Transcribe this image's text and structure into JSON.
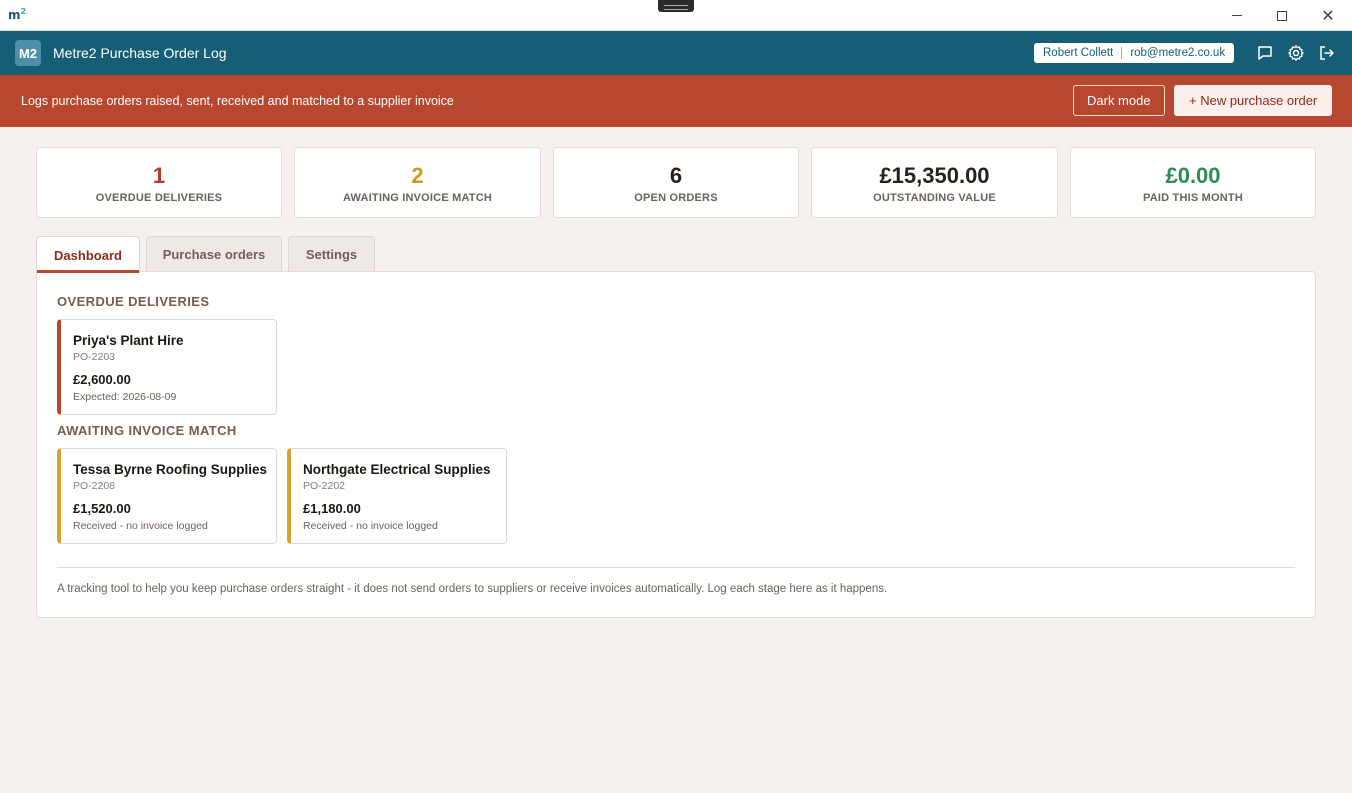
{
  "window": {
    "logo": "m2",
    "controls": {
      "minimize": "minimize",
      "maximize": "maximize",
      "close": "close"
    }
  },
  "header": {
    "badge": "M2",
    "title": "Metre2 Purchase Order Log",
    "user_name": "Robert Collett",
    "user_email": "rob@metre2.co.uk",
    "icons": [
      "chat-icon",
      "gear-icon",
      "logout-icon"
    ]
  },
  "banner": {
    "text": "Logs purchase orders raised, sent, received and matched to a supplier invoice",
    "dark_mode_label": "Dark mode",
    "new_order_label": "+ New purchase order"
  },
  "stats": [
    {
      "value": "1",
      "label": "OVERDUE DELIVERIES",
      "color": "#b83a2b"
    },
    {
      "value": "2",
      "label": "AWAITING INVOICE MATCH",
      "color": "#d19a1f"
    },
    {
      "value": "6",
      "label": "OPEN ORDERS",
      "color": "#2a201c"
    },
    {
      "value": "£15,350.00",
      "label": "OUTSTANDING VALUE",
      "color": "#2a201c"
    },
    {
      "value": "£0.00",
      "label": "PAID THIS MONTH",
      "color": "#2e8b57"
    }
  ],
  "tabs": [
    {
      "label": "Dashboard",
      "active": true
    },
    {
      "label": "Purchase orders",
      "active": false
    },
    {
      "label": "Settings",
      "active": false
    }
  ],
  "dashboard": {
    "overdue_title": "OVERDUE DELIVERIES",
    "overdue": [
      {
        "supplier": "Priya's Plant Hire",
        "po": "PO-2203",
        "amount": "£2,600.00",
        "note": "Expected: 2026-08-09"
      }
    ],
    "awaiting_title": "AWAITING INVOICE MATCH",
    "awaiting": [
      {
        "supplier": "Tessa Byrne Roofing Supplies",
        "po": "PO-2208",
        "amount": "£1,520.00",
        "note": "Received - no invoice logged"
      },
      {
        "supplier": "Northgate Electrical Supplies",
        "po": "PO-2202",
        "amount": "£1,180.00",
        "note": "Received - no invoice logged"
      }
    ],
    "footer": "A tracking tool to help you keep purchase orders straight - it does not send orders to suppliers or receive invoices automatically. Log each stage here as it happens."
  },
  "colors": {
    "header_bg": "#155e75",
    "banner_bg": "#b84730",
    "overdue_accent": "#b84730",
    "awaiting_accent": "#d4a72c"
  }
}
